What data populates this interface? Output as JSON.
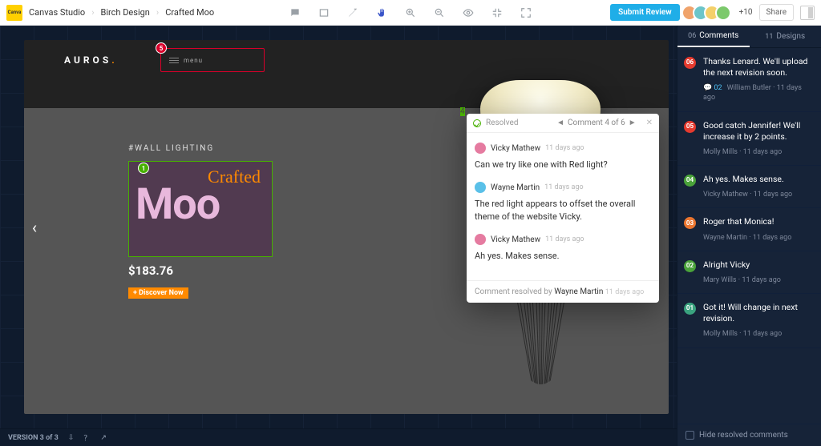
{
  "topbar": {
    "app": "Canvas Studio",
    "crumb1": "Birch Design",
    "crumb2": "Crafted Moo",
    "submit": "Submit Review",
    "plus_count": "+10",
    "share": "Share"
  },
  "canvas": {
    "brand": "AUROS",
    "menu": "menu",
    "pin_top": "5",
    "pin_sel": "1",
    "tag": "#WALL LIGHTING",
    "script": "Crafted",
    "big_word": "Moo",
    "price": "$183.76",
    "discover": "+ Discover Now"
  },
  "popup": {
    "status": "Resolved",
    "pager": "Comment 4 of 6",
    "pin": "4",
    "resolved_prefix": "Comment resolved by ",
    "resolved_by": "Wayne Martin",
    "resolved_when": "11 days ago",
    "entries": [
      {
        "who": "Vicky Mathew",
        "when": "11 days ago",
        "msg": "Can we try like one with Red light?",
        "color": "#e57ba0"
      },
      {
        "who": "Wayne Martin",
        "when": "11 days ago",
        "msg": "The red light appears to offset the overall theme of the website Vicky.",
        "color": "#5ac0e8"
      },
      {
        "who": "Vicky Mathew",
        "when": "11 days ago",
        "msg": "Ah yes. Makes sense.",
        "color": "#e57ba0"
      }
    ]
  },
  "panel": {
    "tab_comments_count": "06",
    "tab_comments": "Comments",
    "tab_designs_count": "11",
    "tab_designs": "Designs",
    "hide_resolved": "Hide resolved comments",
    "items": [
      {
        "badge": "06",
        "cls": "bg-red",
        "title": "Thanks Lenard. We'll upload the next revision soon.",
        "reply": "02",
        "who": "William Butler",
        "when": "11 days ago"
      },
      {
        "badge": "05",
        "cls": "bg-red",
        "title": "Good catch Jennifer! We'll increase it by 2 points.",
        "who": "Molly Mills",
        "when": "11 days ago"
      },
      {
        "badge": "04",
        "cls": "bg-green",
        "title": "Ah yes. Makes sense.",
        "who": "Vicky Mathew",
        "when": "11 days ago"
      },
      {
        "badge": "03",
        "cls": "bg-orange",
        "title": "Roger that Monica!",
        "who": "Wayne Martin",
        "when": "11 days ago"
      },
      {
        "badge": "02",
        "cls": "bg-green",
        "title": "Alright Vicky",
        "who": "Mary Wills",
        "when": "11 days ago"
      },
      {
        "badge": "01",
        "cls": "bg-teal",
        "title": "Got it! Will change in next revision.",
        "who": "Molly Mills",
        "when": "11 days ago"
      }
    ]
  },
  "footer": {
    "version": "VERSION 3 of 3"
  }
}
